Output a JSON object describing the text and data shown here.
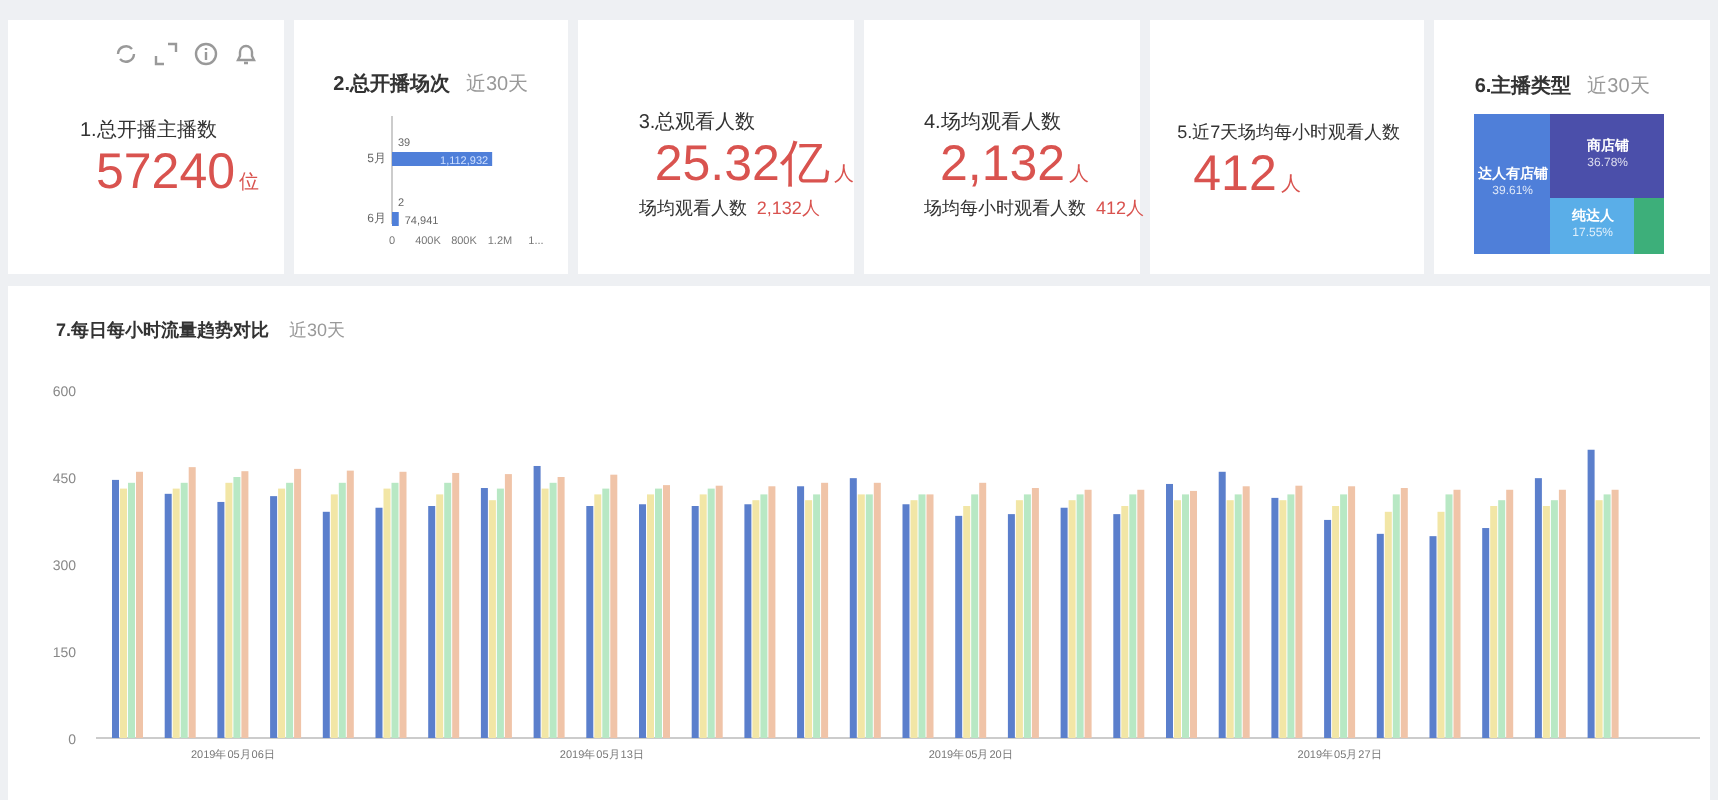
{
  "cards": [
    {
      "kind": "stat",
      "title": "1.总开播主播数",
      "value": "57240",
      "unit": "位",
      "toolbar": true
    },
    {
      "kind": "bar_chart",
      "title": "2.总开播场次",
      "period": "近30天",
      "chart_data": {
        "type": "bar",
        "orientation": "horizontal",
        "categories": [
          "5月",
          "6月"
        ],
        "values": [
          1112932,
          74941
        ],
        "value_labels": [
          "1,112,932",
          "74,941"
        ],
        "xlim": [
          0,
          1600000
        ],
        "xticks": [
          0,
          {
            "value": 400000,
            "label": "400K"
          },
          {
            "value": 800000,
            "label": "800K"
          },
          {
            "value": 1200000,
            "label": "1.2M"
          },
          {
            "value": 1600000,
            "label": "1..."
          }
        ]
      },
      "counts": [
        "39",
        "2"
      ]
    },
    {
      "kind": "stat",
      "title": "3.总观看人数",
      "value": "25.32亿",
      "unit": "人",
      "sub_label": "场均观看人数",
      "sub_value": "2,132人"
    },
    {
      "kind": "stat",
      "title": "4.场均观看人数",
      "value": "2,132",
      "unit": "人",
      "sub_label": "场均每小时观看人数",
      "sub_value": "412人"
    },
    {
      "kind": "stat",
      "title": "5.近7天场均每小时观看人数",
      "value": "412",
      "unit": "人"
    },
    {
      "kind": "treemap",
      "title": "6.主播类型",
      "period": "近30天",
      "tiles": [
        {
          "label": "达人有店铺",
          "percent": "39.61%",
          "color": "#4f7fd9"
        },
        {
          "label": "商店铺",
          "percent": "36.78%",
          "color": "#4b4faa"
        },
        {
          "label": "纯达人",
          "percent": "17.55%",
          "color": "#5aaee8"
        },
        {
          "color": "#3daf7a"
        }
      ]
    }
  ],
  "trend": {
    "title": "7.每日每小时流量趋势对比",
    "period": "近30天",
    "chart_data": {
      "type": "bar",
      "ylim": [
        0,
        600
      ],
      "yticks": [
        0,
        150,
        300,
        450,
        600
      ],
      "stacked": false,
      "categories": [
        null,
        null,
        "2019年05月06日",
        null,
        null,
        null,
        null,
        null,
        null,
        "2019年05月13日",
        null,
        null,
        null,
        null,
        null,
        null,
        "2019年05月20日",
        null,
        null,
        null,
        null,
        null,
        null,
        "2019年05月27日",
        null,
        null,
        null,
        null,
        null
      ],
      "series": [
        {
          "color": "#5b7fcc",
          "values": [
            445,
            421,
            407,
            417,
            390,
            397,
            400,
            431,
            469,
            400,
            403,
            400,
            403,
            434,
            448,
            403,
            383,
            386,
            397,
            386,
            438,
            459,
            414,
            376,
            352,
            348,
            362,
            448,
            497
          ]
        },
        {
          "color": "#f2e6a6",
          "values": [
            430,
            430,
            440,
            430,
            420,
            430,
            420,
            410,
            430,
            420,
            420,
            420,
            410,
            410,
            420,
            410,
            400,
            410,
            410,
            400,
            410,
            410,
            410,
            400,
            390,
            390,
            400,
            400,
            410
          ]
        },
        {
          "color": "#b8e8c4",
          "values": [
            440,
            440,
            450,
            440,
            440,
            440,
            440,
            430,
            440,
            430,
            430,
            430,
            420,
            420,
            420,
            420,
            420,
            420,
            420,
            420,
            420,
            420,
            420,
            420,
            420,
            420,
            410,
            410,
            420
          ]
        },
        {
          "color": "#f0c4a8",
          "values": [
            459,
            467,
            460,
            464,
            461,
            459,
            457,
            455,
            450,
            454,
            436,
            435,
            434,
            440,
            440,
            420,
            440,
            431,
            428,
            428,
            426,
            434,
            435,
            434,
            431,
            428,
            428,
            428,
            428
          ]
        }
      ]
    }
  }
}
